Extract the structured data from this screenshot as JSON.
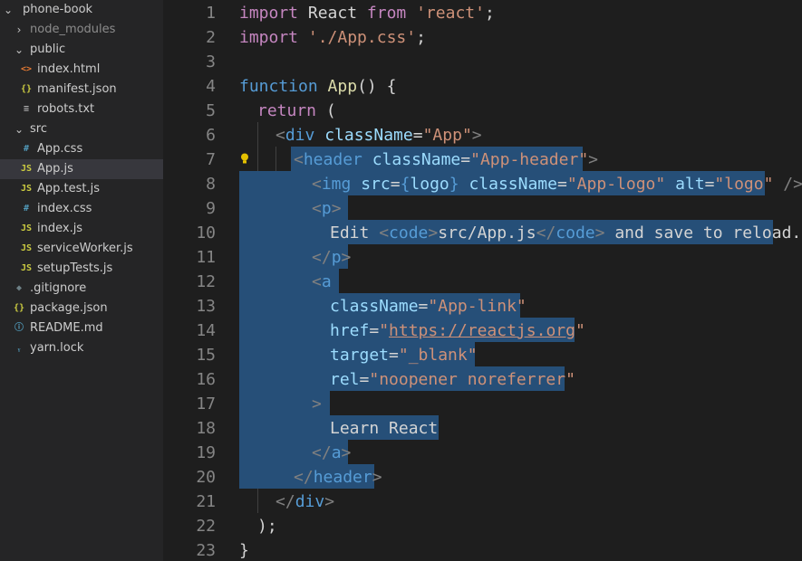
{
  "explorer": {
    "root": "phone-book",
    "node_modules": "node_modules",
    "public": "public",
    "public_files": [
      "index.html",
      "manifest.json",
      "robots.txt"
    ],
    "src": "src",
    "src_files": [
      "App.css",
      "App.js",
      "App.test.js",
      "index.css",
      "index.js",
      "serviceWorker.js",
      "setupTests.js"
    ],
    "root_files": [
      ".gitignore",
      "package.json",
      "README.md",
      "yarn.lock"
    ],
    "selected_file": "App.js"
  },
  "editor": {
    "line_numbers": [
      "1",
      "2",
      "3",
      "4",
      "5",
      "6",
      "7",
      "8",
      "9",
      "10",
      "11",
      "12",
      "13",
      "14",
      "15",
      "16",
      "17",
      "18",
      "19",
      "20",
      "21",
      "22",
      "23"
    ],
    "code": {
      "l1": [
        "import",
        " React ",
        "from",
        " ",
        "'react'",
        ";"
      ],
      "l2": [
        "import",
        " ",
        "'./App.css'",
        ";"
      ],
      "l4": [
        "function",
        " ",
        "App",
        "() {"
      ],
      "l5": [
        "return",
        " ("
      ],
      "l6": [
        "<",
        "div",
        " ",
        "className",
        "=",
        "\"App\"",
        ">"
      ],
      "l7": [
        "<",
        "header",
        " ",
        "className",
        "=",
        "\"App-header\"",
        ">"
      ],
      "l8": [
        "<",
        "img",
        " ",
        "src",
        "=",
        "{",
        "logo",
        "}",
        " ",
        "className",
        "=",
        "\"App-logo\"",
        " ",
        "alt",
        "=",
        "\"logo\"",
        " ",
        "/>"
      ],
      "l9": [
        "<",
        "p",
        ">"
      ],
      "l10": [
        "Edit ",
        "<",
        "code",
        ">",
        "src/App.js",
        "</",
        "code",
        ">",
        " and save to reload."
      ],
      "l11": [
        "</",
        "p",
        ">"
      ],
      "l12": [
        "<",
        "a"
      ],
      "l13": [
        "className",
        "=",
        "\"App-link\""
      ],
      "l14": [
        "href",
        "=",
        "\"",
        "https://reactjs.org",
        "\""
      ],
      "l15": [
        "target",
        "=",
        "\"_blank\""
      ],
      "l16": [
        "rel",
        "=",
        "\"noopener noreferrer\""
      ],
      "l17": [
        ">"
      ],
      "l18": [
        "Learn React"
      ],
      "l19": [
        "</",
        "a",
        ">"
      ],
      "l20": [
        "</",
        "header",
        ">"
      ],
      "l21": [
        "</",
        "div",
        ">"
      ],
      "l22": [
        ");"
      ],
      "l23": [
        "}"
      ]
    },
    "colors": {
      "keyword": "#c586c0",
      "storage": "#569cd6",
      "function": "#dcdcaa",
      "string": "#ce9178",
      "attribute": "#9cdcfe",
      "tag": "#569cd6",
      "selection": "#264f78"
    }
  }
}
